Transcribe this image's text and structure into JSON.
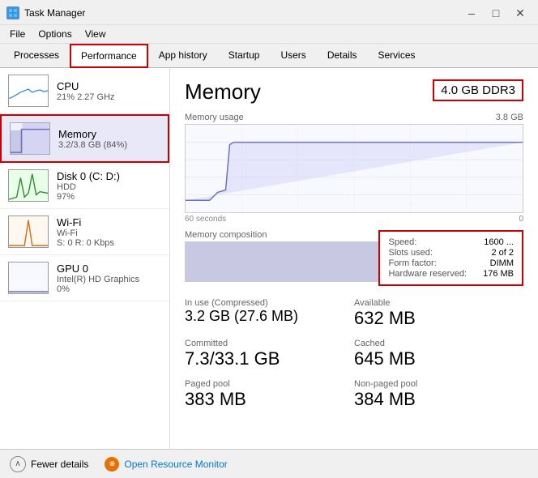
{
  "window": {
    "title": "Task Manager",
    "controls": [
      "–",
      "□",
      "✕"
    ]
  },
  "menu": {
    "items": [
      "File",
      "Options",
      "View"
    ]
  },
  "tabs": {
    "items": [
      "Processes",
      "Performance",
      "App history",
      "Startup",
      "Users",
      "Details",
      "Services"
    ],
    "active": "Performance",
    "highlighted": "Performance"
  },
  "sidebar": {
    "items": [
      {
        "name": "CPU",
        "detail1": "21% 2.27 GHz",
        "detail2": "",
        "type": "cpu"
      },
      {
        "name": "Memory",
        "detail1": "3.2/3.8 GB (84%)",
        "detail2": "",
        "type": "memory",
        "active": true
      },
      {
        "name": "Disk 0 (C: D:)",
        "detail1": "HDD",
        "detail2": "97%",
        "type": "disk"
      },
      {
        "name": "Wi-Fi",
        "detail1": "Wi-Fi",
        "detail2": "S: 0 R: 0 Kbps",
        "type": "wifi"
      },
      {
        "name": "GPU 0",
        "detail1": "Intel(R) HD Graphics",
        "detail2": "0%",
        "type": "gpu"
      }
    ]
  },
  "panel": {
    "title": "Memory",
    "badge": "4.0 GB DDR3",
    "chart_label": "Memory usage",
    "chart_max": "3.8 GB",
    "time_left": "60 seconds",
    "time_right": "0",
    "composition_label": "Memory composition",
    "stats": {
      "in_use_label": "In use (Compressed)",
      "in_use_value": "3.2 GB (27.6 MB)",
      "available_label": "Available",
      "available_value": "632 MB",
      "committed_label": "Committed",
      "committed_value": "7.3/33.1 GB",
      "cached_label": "Cached",
      "cached_value": "645 MB",
      "paged_label": "Paged pool",
      "paged_value": "383 MB",
      "nonpaged_label": "Non-paged pool",
      "nonpaged_value": "384 MB"
    },
    "info": {
      "speed_label": "Speed:",
      "speed_value": "1600 ...",
      "slots_label": "Slots used:",
      "slots_value": "2 of 2",
      "form_label": "Form factor:",
      "form_value": "DIMM",
      "hw_label": "Hardware reserved:",
      "hw_value": "176 MB"
    }
  },
  "bottom": {
    "fewer_details": "Fewer details",
    "open_monitor": "Open Resource Monitor"
  }
}
